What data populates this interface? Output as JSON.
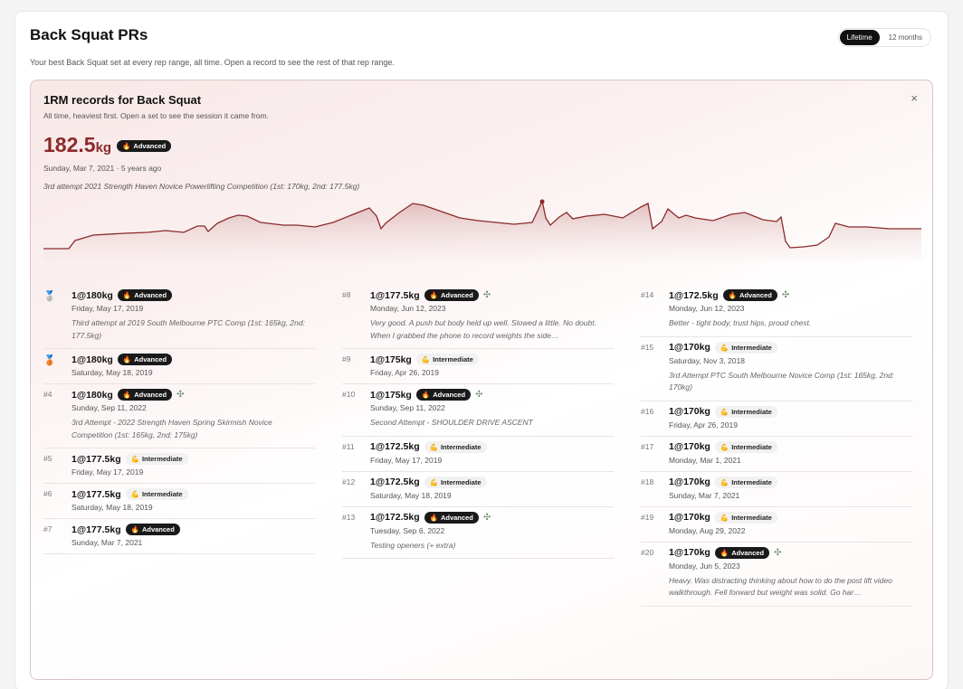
{
  "header": {
    "title": "Back Squat PRs",
    "subtitle": "Your best Back Squat set at every rep range, all time. Open a record to see the rest of that rep range.",
    "toggle": [
      "Lifetime",
      "12 months"
    ]
  },
  "panel": {
    "title": "1RM records for Back Squat",
    "subtitle": "All time, heaviest first. Open a set to see the session it came from.",
    "close": "×",
    "hero": {
      "value": "182.5",
      "unit": "kg",
      "badge": "Advanced",
      "date": "Sunday, Mar 7, 2021 · 5 years ago",
      "note": "3rd attempt 2021 Strength Haven Novice Powerlifting Competition (1st: 170kg, 2nd: 177.5kg)"
    }
  },
  "colors": {
    "accent": "#8b2a2a",
    "advanced": "#1a1a1a",
    "intermediate": "#f1f1f1"
  },
  "columns": [
    [
      {
        "rank": "",
        "medal": "silver",
        "set": "1@180kg",
        "badge": "Advanced",
        "level": "advanced",
        "pin": false,
        "date": "Friday, May 17, 2019",
        "note": "Third attempt at 2019 South Melbourne PTC Comp (1st: 165kg, 2nd: 177.5kg)"
      },
      {
        "rank": "",
        "medal": "bronze",
        "set": "1@180kg",
        "badge": "Advanced",
        "level": "advanced",
        "pin": false,
        "date": "Saturday, May 18, 2019",
        "note": ""
      },
      {
        "rank": "#4",
        "set": "1@180kg",
        "badge": "Advanced",
        "level": "advanced",
        "pin": true,
        "date": "Sunday, Sep 11, 2022",
        "note": "3rd Attempt - 2022 Strength Haven Spring Skirmish Novice Competition (1st: 165kg, 2nd: 175kg)"
      },
      {
        "rank": "#5",
        "set": "1@177.5kg",
        "badge": "Intermediate",
        "level": "intermediate",
        "pin": false,
        "date": "Friday, May 17, 2019",
        "note": ""
      },
      {
        "rank": "#6",
        "set": "1@177.5kg",
        "badge": "Intermediate",
        "level": "intermediate",
        "pin": false,
        "date": "Saturday, May 18, 2019",
        "note": ""
      },
      {
        "rank": "#7",
        "set": "1@177.5kg",
        "badge": "Advanced",
        "level": "advanced",
        "pin": false,
        "date": "Sunday, Mar 7, 2021",
        "note": ""
      }
    ],
    [
      {
        "rank": "#8",
        "set": "1@177.5kg",
        "badge": "Advanced",
        "level": "advanced",
        "pin": true,
        "date": "Monday, Jun 12, 2023",
        "note": "Very good. A push but body held up well. Slowed a little. No doubt. When I grabbed the phone to record weights the side…"
      },
      {
        "rank": "#9",
        "set": "1@175kg",
        "badge": "Intermediate",
        "level": "intermediate",
        "pin": false,
        "date": "Friday, Apr 26, 2019",
        "note": ""
      },
      {
        "rank": "#10",
        "set": "1@175kg",
        "badge": "Advanced",
        "level": "advanced",
        "pin": true,
        "date": "Sunday, Sep 11, 2022",
        "note": "Second Attempt - SHOULDER DRIVE ASCENT"
      },
      {
        "rank": "#11",
        "set": "1@172.5kg",
        "badge": "Intermediate",
        "level": "intermediate",
        "pin": false,
        "date": "Friday, May 17, 2019",
        "note": ""
      },
      {
        "rank": "#12",
        "set": "1@172.5kg",
        "badge": "Intermediate",
        "level": "intermediate",
        "pin": false,
        "date": "Saturday, May 18, 2019",
        "note": ""
      },
      {
        "rank": "#13",
        "set": "1@172.5kg",
        "badge": "Advanced",
        "level": "advanced",
        "pin": true,
        "date": "Tuesday, Sep 6, 2022",
        "note": "Testing openers (+ extra)"
      }
    ],
    [
      {
        "rank": "#14",
        "set": "1@172.5kg",
        "badge": "Advanced",
        "level": "advanced",
        "pin": true,
        "date": "Monday, Jun 12, 2023",
        "note": "Better - tight body, trust hips, proud chest."
      },
      {
        "rank": "#15",
        "set": "1@170kg",
        "badge": "Intermediate",
        "level": "intermediate",
        "pin": false,
        "date": "Saturday, Nov 3, 2018",
        "note": "3rd Attempt PTC South Melbourne Novice Comp (1st: 165kg, 2nd: 170kg)"
      },
      {
        "rank": "#16",
        "set": "1@170kg",
        "badge": "Intermediate",
        "level": "intermediate",
        "pin": false,
        "date": "Friday, Apr 26, 2019",
        "note": ""
      },
      {
        "rank": "#17",
        "set": "1@170kg",
        "badge": "Intermediate",
        "level": "intermediate",
        "pin": false,
        "date": "Monday, Mar 1, 2021",
        "note": ""
      },
      {
        "rank": "#18",
        "set": "1@170kg",
        "badge": "Intermediate",
        "level": "intermediate",
        "pin": false,
        "date": "Sunday, Mar 7, 2021",
        "note": ""
      },
      {
        "rank": "#19",
        "set": "1@170kg",
        "badge": "Intermediate",
        "level": "intermediate",
        "pin": false,
        "date": "Monday, Aug 29, 2022",
        "note": ""
      },
      {
        "rank": "#20",
        "set": "1@170kg",
        "badge": "Advanced",
        "level": "advanced",
        "pin": true,
        "date": "Monday, Jun 5, 2023",
        "note": "Heavy. Was distracting thinking about how to do the post lift video walkthrough. Fell forward but weight was solid. Go har…"
      }
    ]
  ]
}
